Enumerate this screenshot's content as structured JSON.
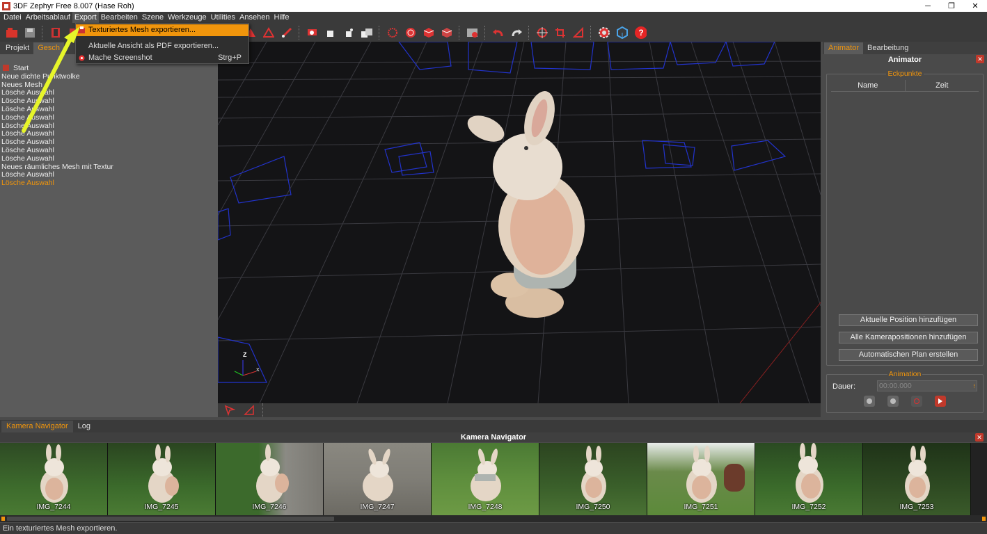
{
  "window": {
    "title": "3DF Zephyr Free 8.007 (Hase Roh)",
    "minimize": "─",
    "restore": "❐",
    "close": "✕"
  },
  "menubar": [
    "Datei",
    "Arbeitsablauf",
    "Export",
    "Bearbeiten",
    "Szene",
    "Werkzeuge",
    "Utilities",
    "Ansehen",
    "Hilfe"
  ],
  "export_menu": {
    "items": [
      {
        "label": "Texturiertes Mesh exportieren...",
        "shortcut": ""
      },
      {
        "label": "Aktuelle Ansicht als PDF exportieren...",
        "shortcut": ""
      },
      {
        "label": "Mache Screenshot",
        "shortcut": "Strg+P"
      }
    ]
  },
  "left_panel": {
    "tabs": [
      "Projekt",
      "Gesch"
    ],
    "history": [
      "Start",
      "Neue dichte Punktwolke",
      "Neues Mesh",
      "Lösche Auswahl",
      "Lösche Auswahl",
      "Lösche Auswahl",
      "Lösche Auswahl",
      "Lösche Auswahl",
      "Lösche Auswahl",
      "Lösche Auswahl",
      "Lösche Auswahl",
      "Lösche Auswahl",
      "Neues räumliches Mesh mit Textur",
      "Lösche Auswahl",
      "Lösche Auswahl"
    ]
  },
  "viewport": {
    "axis_z": "Z",
    "axis_x": "X"
  },
  "right_panel": {
    "tabs": [
      "Animator",
      "Bearbeitung"
    ],
    "title": "Animator",
    "eckpunkte": {
      "label": "Eckpunkte",
      "col_name": "Name",
      "col_time": "Zeit"
    },
    "buttons": [
      "Aktuelle Position hinzufügen",
      "Alle Kamerapositionen hinzufügen",
      "Automatischen Plan erstellen"
    ],
    "animation": {
      "label": "Animation",
      "duration_label": "Dauer:",
      "duration_value": "00:00.000"
    }
  },
  "bottom": {
    "tabs": [
      "Kamera Navigator",
      "Log"
    ],
    "title": "Kamera Navigator",
    "thumbnails": [
      "IMG_7244",
      "IMG_7245",
      "IMG_7246",
      "IMG_7247",
      "IMG_7248",
      "IMG_7250",
      "IMG_7251",
      "IMG_7252",
      "IMG_7253"
    ]
  },
  "status": "Ein texturiertes Mesh exportieren.",
  "colors": {
    "accent": "#f0950c",
    "highlight_arrow": "#e6f52a",
    "camera_frame": "#2233cc"
  }
}
